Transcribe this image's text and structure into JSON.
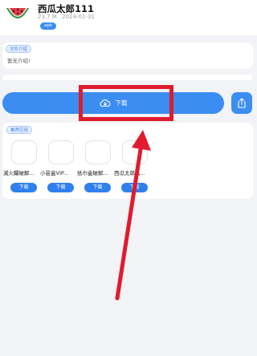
{
  "app": {
    "name": "西瓜太郎111",
    "size": "23.7 M",
    "date": "2024-01-31",
    "badge": "apk"
  },
  "intro": {
    "tag": "文件介绍",
    "text": "暂无介绍!"
  },
  "actions": {
    "download_label": "下载",
    "share_icon": "share-icon",
    "cloud_icon": "cloud-download-icon"
  },
  "recommended": {
    "tag": "推荐应用",
    "items": [
      {
        "name": "滅火矚破解...",
        "button": "下载"
      },
      {
        "name": "小芸盒VIP...",
        "button": "下载"
      },
      {
        "name": "纸巾盒破解...",
        "button": "下载"
      },
      {
        "name": "西瓜太郎晶...",
        "button": "下载"
      }
    ]
  },
  "colors": {
    "accent": "#3b8df2",
    "annotation": "#e01b2f",
    "background": "#f1f3f6"
  }
}
